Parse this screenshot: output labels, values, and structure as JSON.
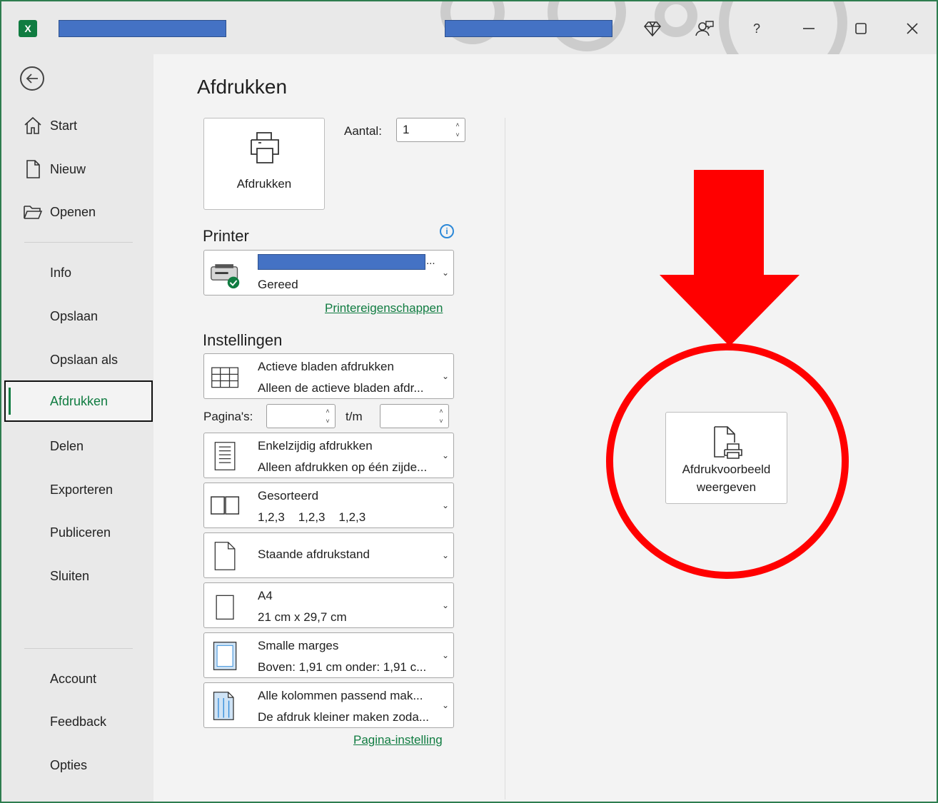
{
  "titlebar": {
    "help": "?",
    "icons": [
      "excel-icon",
      "diamond-icon",
      "feedback-icon",
      "help-icon",
      "minimize-icon",
      "maximize-icon",
      "close-icon"
    ]
  },
  "sidebar": {
    "top_items": [
      {
        "label": "Start",
        "icon": "home-icon"
      },
      {
        "label": "Nieuw",
        "icon": "new-document-icon"
      },
      {
        "label": "Openen",
        "icon": "folder-open-icon"
      }
    ],
    "middle_items": [
      "Info",
      "Opslaan",
      "Opslaan als",
      "Afdrukken",
      "Delen",
      "Exporteren",
      "Publiceren",
      "Sluiten"
    ],
    "active": "Afdrukken",
    "bottom_items": [
      "Account",
      "Feedback",
      "Opties"
    ]
  },
  "main": {
    "title": "Afdrukken",
    "print_button": "Afdrukken",
    "copies_label": "Aantal:",
    "copies_value": "1",
    "printer": {
      "section": "Printer",
      "name_suffix": "...",
      "status": "Gereed",
      "properties_link": "Printereigenschappen"
    },
    "settings": {
      "section": "Instellingen",
      "what": {
        "t1": "Actieve bladen afdrukken",
        "t2": "Alleen de actieve bladen afdr..."
      },
      "pages_label": "Pagina's:",
      "to_label": "t/m",
      "sides": {
        "t1": "Enkelzijdig afdrukken",
        "t2": "Alleen afdrukken op één zijde..."
      },
      "collate": {
        "t1": "Gesorteerd",
        "t2": "1,2,3    1,2,3    1,2,3"
      },
      "orientation": "Staande afdrukstand",
      "paper": {
        "t1": "A4",
        "t2": "21 cm x 29,7 cm"
      },
      "margins": {
        "t1": "Smalle marges",
        "t2": "Boven: 1,91 cm onder: 1,91 c..."
      },
      "scaling": {
        "t1": "Alle kolommen passend mak...",
        "t2": "De afdruk kleiner maken zoda..."
      },
      "page_setup_link": "Pagina-instelling"
    },
    "preview": {
      "line1": "Afdrukvoorbeeld",
      "line2": "weergeven"
    }
  },
  "colors": {
    "accent": "#107c41",
    "annotation": "#ff0000",
    "redaction": "#4472c4"
  }
}
